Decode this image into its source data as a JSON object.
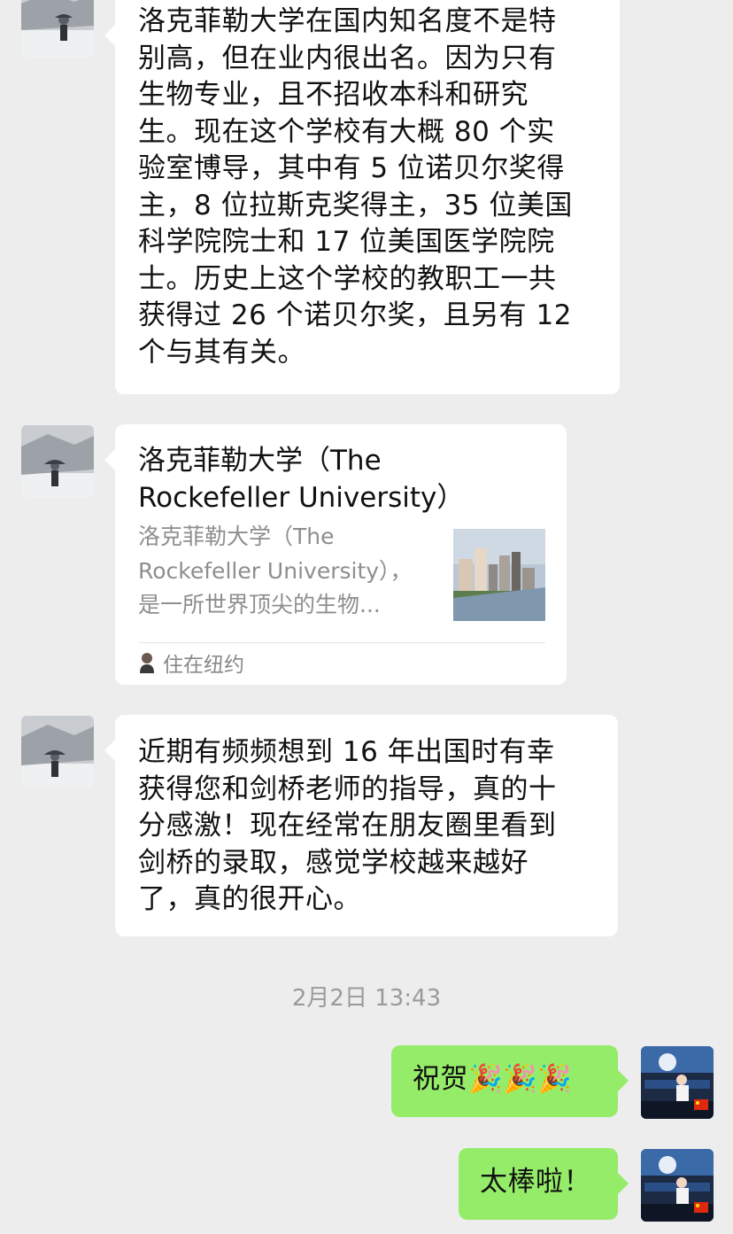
{
  "conversation": {
    "messages": [
      {
        "sender": "contact",
        "type": "text",
        "text": "洛克菲勒大学在国内知名度不是特\n别高，但在业内很出名。因为只有\n生物专业，且不招收本科和研究\n生。现在这个学校有大概 80 个实\n验室博导，其中有 5 位诺贝尔奖得\n主，8 位拉斯克奖得主，35 位美国\n科学院院士和 17 位美国医学院院\n士。历史上这个学校的教职工一共\n获得过 26 个诺贝尔奖，且另有 12\n个与其有关。"
      },
      {
        "sender": "contact",
        "type": "link_card",
        "title": "洛克菲勒大学（The\nRockefeller University）",
        "description": "洛克菲勒大学（The\nRockefeller University），\n是一所世界顶尖的生物...",
        "source_icon": "person-avatar-icon",
        "source_label": "住在纽约"
      },
      {
        "sender": "contact",
        "type": "text",
        "text": "近期有频频想到 16 年出国时有幸\n获得您和剑桥老师的指导，真的十\n分感激！现在经常在朋友圈里看到\n剑桥的录取，感觉学校越来越好\n了，真的很开心。"
      },
      {
        "sender": "me",
        "type": "text",
        "text": "祝贺🎉🎉🎉"
      },
      {
        "sender": "me",
        "type": "text",
        "text": "太棒啦！"
      }
    ],
    "timestamp": "2月2日 13:43"
  },
  "colors": {
    "background": "#ededed",
    "incoming_bubble": "#ffffff",
    "outgoing_bubble": "#95ec69",
    "timestamp_text": "#9a9a9a"
  }
}
